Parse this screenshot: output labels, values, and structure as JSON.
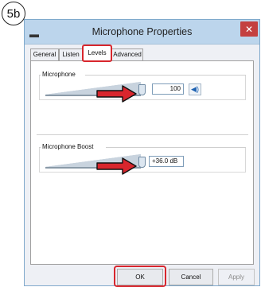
{
  "step_badge": "5b",
  "window": {
    "title": "Microphone Properties",
    "close_glyph": "✕",
    "title_icon": "microphone-icon"
  },
  "tabs": [
    {
      "label": "General",
      "active": false
    },
    {
      "label": "Listen",
      "active": false
    },
    {
      "label": "Levels",
      "active": true
    },
    {
      "label": "Advanced",
      "active": false
    }
  ],
  "microphone": {
    "label": "Microphone",
    "value": "100",
    "level": 1.0,
    "mute_icon": "speaker-icon"
  },
  "boost": {
    "label": "Microphone Boost",
    "value": "+36.0 dB",
    "level": 1.0
  },
  "buttons": {
    "ok": "OK",
    "cancel": "Cancel",
    "apply": "Apply"
  },
  "colors": {
    "highlight": "#d8262d",
    "arrow": "#d8262d",
    "titlebar": "#bcd5ec"
  }
}
